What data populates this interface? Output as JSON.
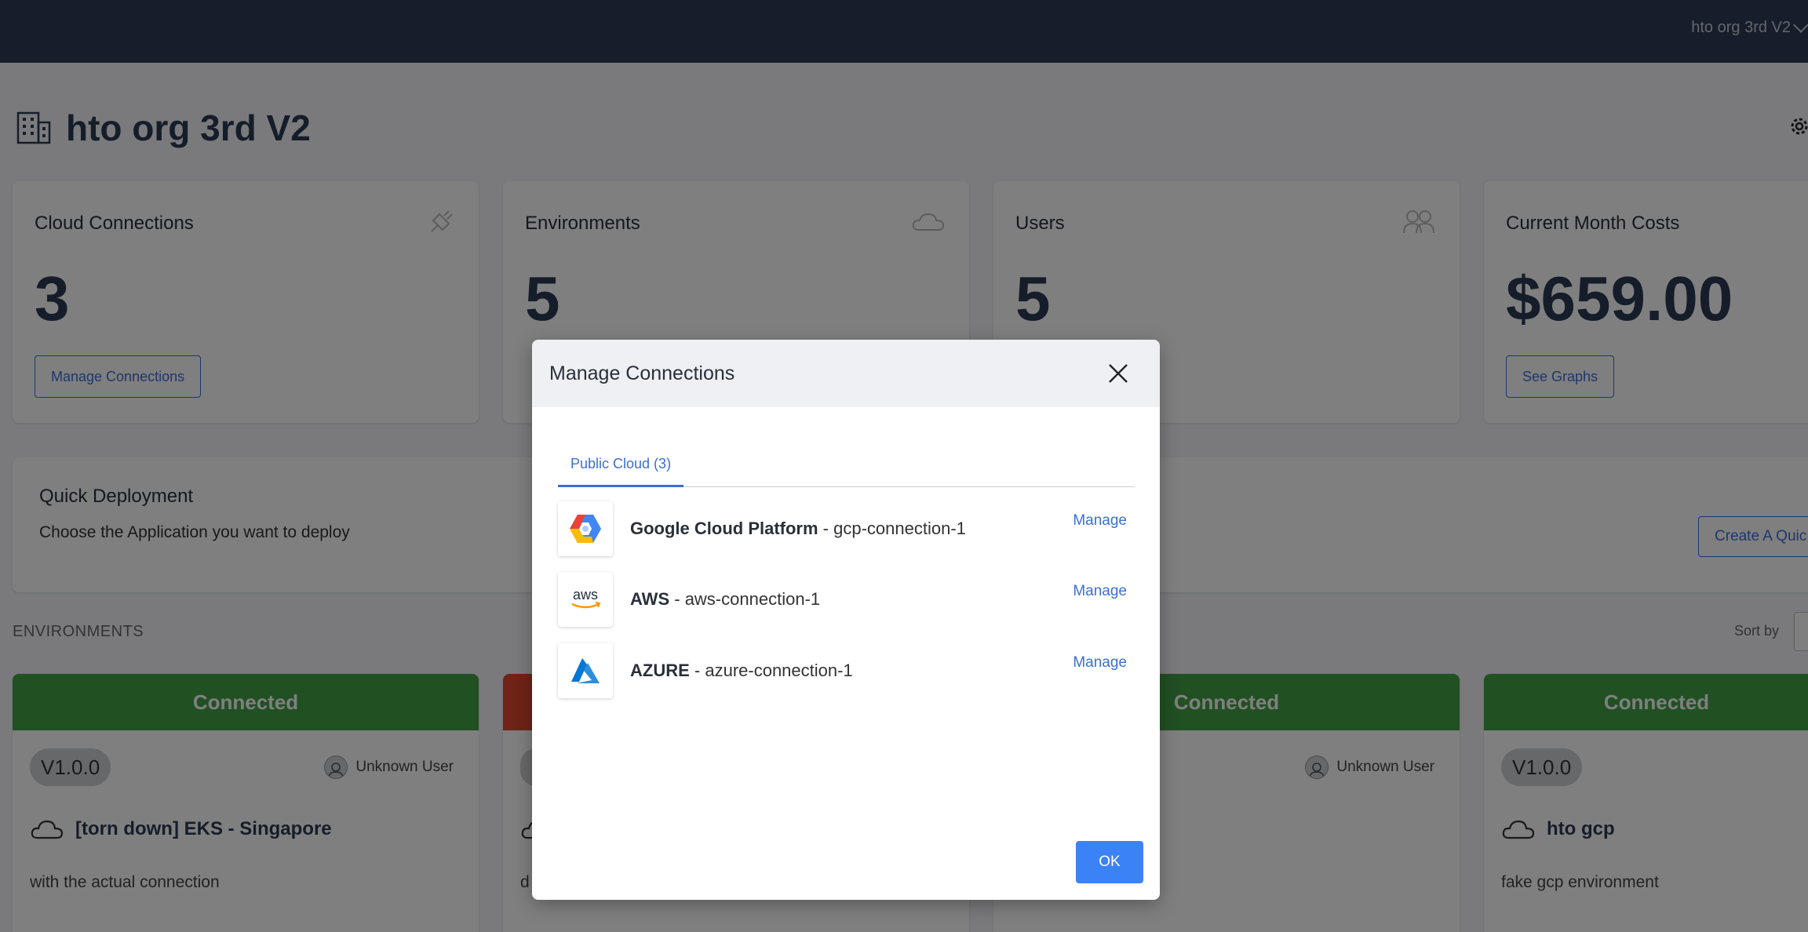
{
  "topbar": {
    "org_switcher": "hto org 3rd V2"
  },
  "page": {
    "title": "hto org 3rd V2"
  },
  "stats": [
    {
      "title": "Cloud Connections",
      "value": "3",
      "button": "Manage Connections",
      "icon": "plug-icon"
    },
    {
      "title": "Environments",
      "value": "5",
      "icon": "cloud-icon"
    },
    {
      "title": "Users",
      "value": "5",
      "icon": "users-icon"
    },
    {
      "title": "Current Month Costs",
      "value": "$659.00",
      "button": "See Graphs"
    }
  ],
  "quick_deployment": {
    "title": "Quick Deployment",
    "subtitle": "Choose the Application you want to deploy",
    "button": "Create A Quic"
  },
  "environments": {
    "heading": "ENVIRONMENTS",
    "sort_label": "Sort by",
    "cards": [
      {
        "status": "Connected",
        "status_color": "#43a047",
        "version": "V1.0.0",
        "owner": "Unknown User",
        "name": "[torn down] EKS - Singapore",
        "description": "with the actual connection"
      },
      {
        "status": "",
        "status_color": "#e0472f",
        "version": "",
        "owner": "",
        "name": "",
        "description": "d"
      },
      {
        "status": "Connected",
        "status_color": "#43a047",
        "version": "",
        "owner": "Unknown User",
        "name": "",
        "description": ""
      },
      {
        "status": "Connected",
        "status_color": "#43a047",
        "version": "V1.0.0",
        "owner": "",
        "name": "hto gcp",
        "description": "fake gcp environment"
      }
    ]
  },
  "modal": {
    "title": "Manage Connections",
    "tab": "Public Cloud (3)",
    "connections": [
      {
        "provider": "Google Cloud Platform",
        "separator": " - ",
        "name": "gcp-connection-1",
        "action": "Manage",
        "logo": "gcp-logo"
      },
      {
        "provider": "AWS",
        "separator": " - ",
        "name": "aws-connection-1",
        "action": "Manage",
        "logo": "aws-logo"
      },
      {
        "provider": "AZURE",
        "separator": " - ",
        "name": "azure-connection-1",
        "action": "Manage",
        "logo": "azure-logo"
      }
    ],
    "ok": "OK"
  },
  "colors": {
    "topbar": "#2f3a56",
    "accent": "#3b6fd4",
    "connected": "#43a047",
    "disconnected": "#e0472f",
    "ok_button": "#3b82f6"
  }
}
